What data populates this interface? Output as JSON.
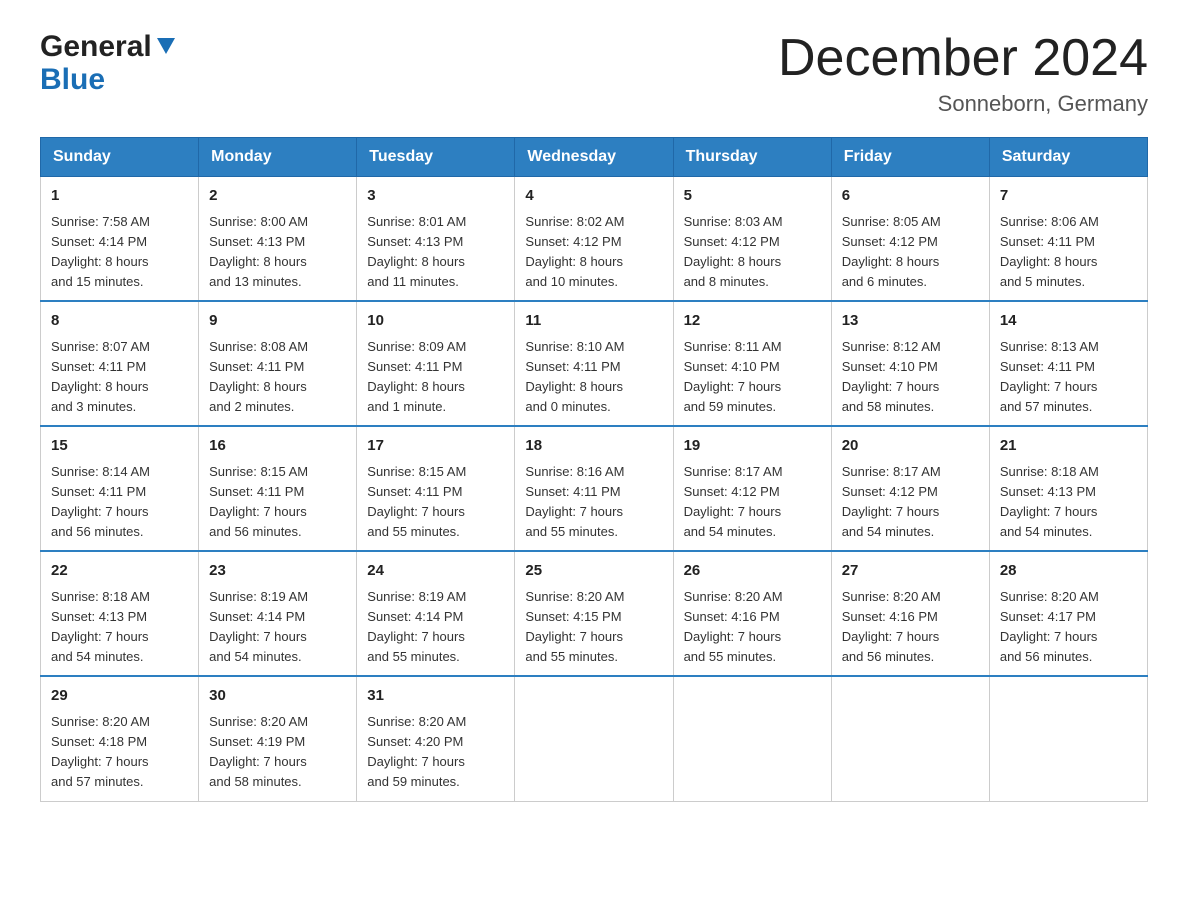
{
  "logo": {
    "general": "General",
    "blue": "Blue"
  },
  "header": {
    "month": "December 2024",
    "location": "Sonneborn, Germany"
  },
  "weekdays": [
    "Sunday",
    "Monday",
    "Tuesday",
    "Wednesday",
    "Thursday",
    "Friday",
    "Saturday"
  ],
  "weeks": [
    [
      {
        "day": "1",
        "info": "Sunrise: 7:58 AM\nSunset: 4:14 PM\nDaylight: 8 hours\nand 15 minutes."
      },
      {
        "day": "2",
        "info": "Sunrise: 8:00 AM\nSunset: 4:13 PM\nDaylight: 8 hours\nand 13 minutes."
      },
      {
        "day": "3",
        "info": "Sunrise: 8:01 AM\nSunset: 4:13 PM\nDaylight: 8 hours\nand 11 minutes."
      },
      {
        "day": "4",
        "info": "Sunrise: 8:02 AM\nSunset: 4:12 PM\nDaylight: 8 hours\nand 10 minutes."
      },
      {
        "day": "5",
        "info": "Sunrise: 8:03 AM\nSunset: 4:12 PM\nDaylight: 8 hours\nand 8 minutes."
      },
      {
        "day": "6",
        "info": "Sunrise: 8:05 AM\nSunset: 4:12 PM\nDaylight: 8 hours\nand 6 minutes."
      },
      {
        "day": "7",
        "info": "Sunrise: 8:06 AM\nSunset: 4:11 PM\nDaylight: 8 hours\nand 5 minutes."
      }
    ],
    [
      {
        "day": "8",
        "info": "Sunrise: 8:07 AM\nSunset: 4:11 PM\nDaylight: 8 hours\nand 3 minutes."
      },
      {
        "day": "9",
        "info": "Sunrise: 8:08 AM\nSunset: 4:11 PM\nDaylight: 8 hours\nand 2 minutes."
      },
      {
        "day": "10",
        "info": "Sunrise: 8:09 AM\nSunset: 4:11 PM\nDaylight: 8 hours\nand 1 minute."
      },
      {
        "day": "11",
        "info": "Sunrise: 8:10 AM\nSunset: 4:11 PM\nDaylight: 8 hours\nand 0 minutes."
      },
      {
        "day": "12",
        "info": "Sunrise: 8:11 AM\nSunset: 4:10 PM\nDaylight: 7 hours\nand 59 minutes."
      },
      {
        "day": "13",
        "info": "Sunrise: 8:12 AM\nSunset: 4:10 PM\nDaylight: 7 hours\nand 58 minutes."
      },
      {
        "day": "14",
        "info": "Sunrise: 8:13 AM\nSunset: 4:11 PM\nDaylight: 7 hours\nand 57 minutes."
      }
    ],
    [
      {
        "day": "15",
        "info": "Sunrise: 8:14 AM\nSunset: 4:11 PM\nDaylight: 7 hours\nand 56 minutes."
      },
      {
        "day": "16",
        "info": "Sunrise: 8:15 AM\nSunset: 4:11 PM\nDaylight: 7 hours\nand 56 minutes."
      },
      {
        "day": "17",
        "info": "Sunrise: 8:15 AM\nSunset: 4:11 PM\nDaylight: 7 hours\nand 55 minutes."
      },
      {
        "day": "18",
        "info": "Sunrise: 8:16 AM\nSunset: 4:11 PM\nDaylight: 7 hours\nand 55 minutes."
      },
      {
        "day": "19",
        "info": "Sunrise: 8:17 AM\nSunset: 4:12 PM\nDaylight: 7 hours\nand 54 minutes."
      },
      {
        "day": "20",
        "info": "Sunrise: 8:17 AM\nSunset: 4:12 PM\nDaylight: 7 hours\nand 54 minutes."
      },
      {
        "day": "21",
        "info": "Sunrise: 8:18 AM\nSunset: 4:13 PM\nDaylight: 7 hours\nand 54 minutes."
      }
    ],
    [
      {
        "day": "22",
        "info": "Sunrise: 8:18 AM\nSunset: 4:13 PM\nDaylight: 7 hours\nand 54 minutes."
      },
      {
        "day": "23",
        "info": "Sunrise: 8:19 AM\nSunset: 4:14 PM\nDaylight: 7 hours\nand 54 minutes."
      },
      {
        "day": "24",
        "info": "Sunrise: 8:19 AM\nSunset: 4:14 PM\nDaylight: 7 hours\nand 55 minutes."
      },
      {
        "day": "25",
        "info": "Sunrise: 8:20 AM\nSunset: 4:15 PM\nDaylight: 7 hours\nand 55 minutes."
      },
      {
        "day": "26",
        "info": "Sunrise: 8:20 AM\nSunset: 4:16 PM\nDaylight: 7 hours\nand 55 minutes."
      },
      {
        "day": "27",
        "info": "Sunrise: 8:20 AM\nSunset: 4:16 PM\nDaylight: 7 hours\nand 56 minutes."
      },
      {
        "day": "28",
        "info": "Sunrise: 8:20 AM\nSunset: 4:17 PM\nDaylight: 7 hours\nand 56 minutes."
      }
    ],
    [
      {
        "day": "29",
        "info": "Sunrise: 8:20 AM\nSunset: 4:18 PM\nDaylight: 7 hours\nand 57 minutes."
      },
      {
        "day": "30",
        "info": "Sunrise: 8:20 AM\nSunset: 4:19 PM\nDaylight: 7 hours\nand 58 minutes."
      },
      {
        "day": "31",
        "info": "Sunrise: 8:20 AM\nSunset: 4:20 PM\nDaylight: 7 hours\nand 59 minutes."
      },
      {
        "day": "",
        "info": ""
      },
      {
        "day": "",
        "info": ""
      },
      {
        "day": "",
        "info": ""
      },
      {
        "day": "",
        "info": ""
      }
    ]
  ]
}
